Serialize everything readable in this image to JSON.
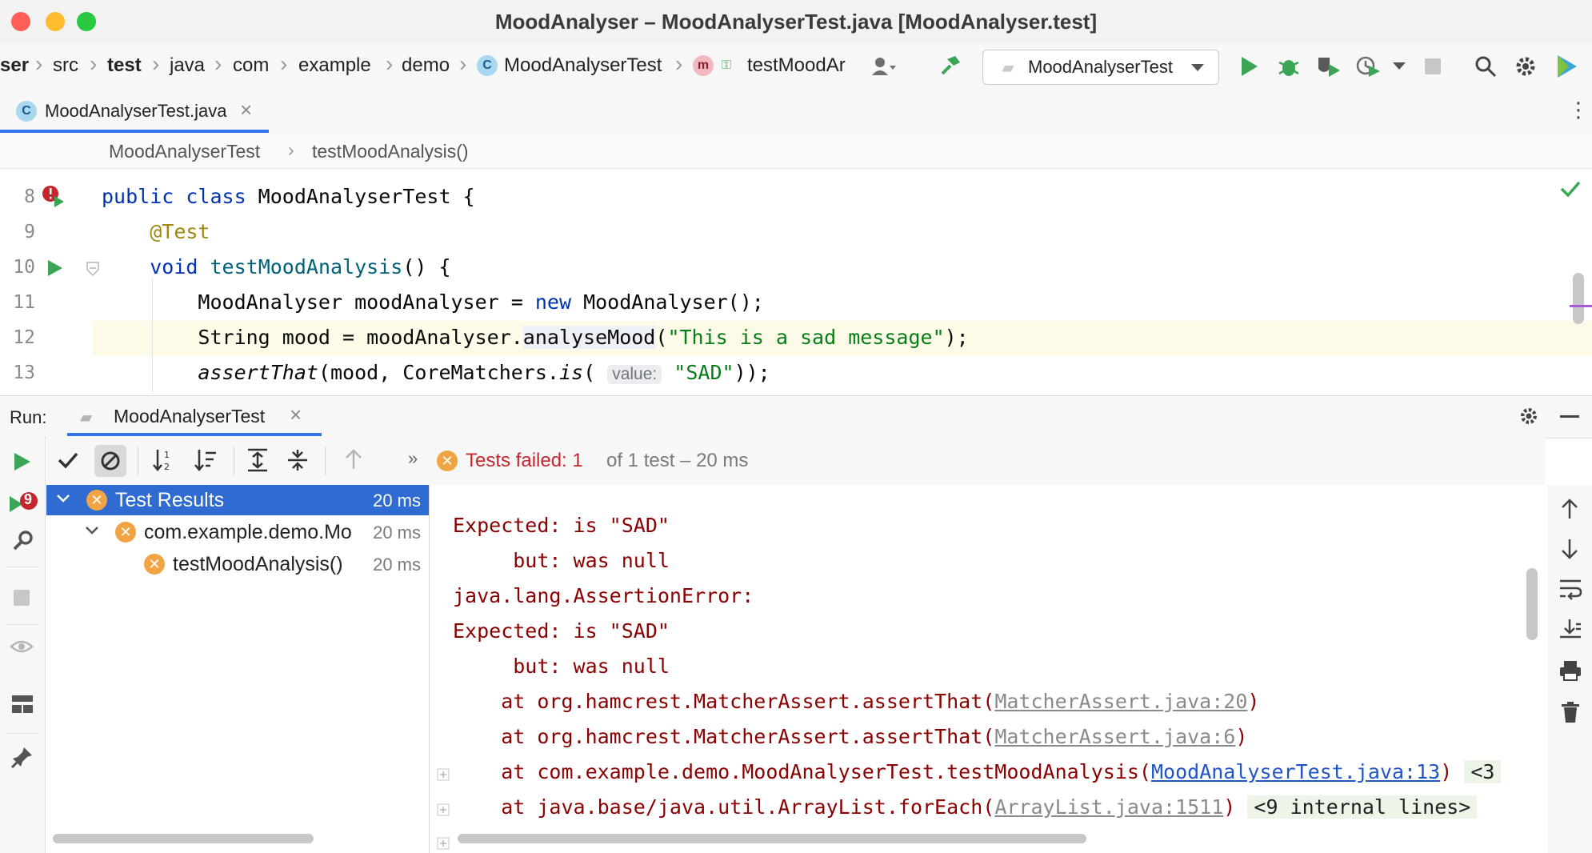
{
  "window": {
    "title": "MoodAnalyser – MoodAnalyserTest.java [MoodAnalyser.test]"
  },
  "nav": {
    "crumbs": [
      "ser",
      "src",
      "test",
      "java",
      "com",
      "example",
      "demo",
      "MoodAnalyserTest",
      "testMoodAr"
    ],
    "run_config": "MoodAnalyserTest"
  },
  "editor_tabs": [
    {
      "label": "MoodAnalyserTest.java",
      "active": true
    }
  ],
  "breadcrumb": [
    "MoodAnalyserTest",
    "testMoodAnalysis()"
  ],
  "code": {
    "line_numbers": [
      "8",
      "9",
      "10",
      "11",
      "12",
      "13"
    ],
    "inlay_hint": "value:"
  },
  "run_panel": {
    "label": "Run:",
    "tab": "MoodAnalyserTest",
    "status": {
      "failed_text": "Tests failed: 1",
      "rest_text": "of 1 test – 20 ms"
    },
    "tree": [
      {
        "label": "Test Results",
        "time": "20 ms"
      },
      {
        "label": "com.example.demo.Mo",
        "time": "20 ms"
      },
      {
        "label": "testMoodAnalysis()",
        "time": "20 ms"
      }
    ],
    "console": {
      "l1": "Expected: is \"SAD\"",
      "l2": "     but: was null",
      "l3": "java.lang.AssertionError:",
      "l4": "Expected: is \"SAD\"",
      "l5": "     but: was null",
      "l6_prefix": "    at org.hamcrest.MatcherAssert.assertThat(",
      "l6_link": "MatcherAssert.java:20",
      "l7_prefix": "    at org.hamcrest.MatcherAssert.assertThat(",
      "l7_link": "MatcherAssert.java:6",
      "l8_prefix": "    at com.example.demo.MoodAnalyserTest.testMoodAnalysis(",
      "l8_link": "MoodAnalyserTest.java:13",
      "l8_fold": "<3",
      "l9_prefix": "    at java.base/java.util.ArrayList.forEach(",
      "l9_link": "ArrayList.java:1511",
      "l9_fold": "<9 internal lines>",
      "close_paren": ")"
    },
    "failed_badge": "9"
  },
  "colors": {
    "accent": "#3574f0",
    "run_green": "#3aa655",
    "error_red": "#c4262e",
    "fail_orange": "#f0a443"
  }
}
